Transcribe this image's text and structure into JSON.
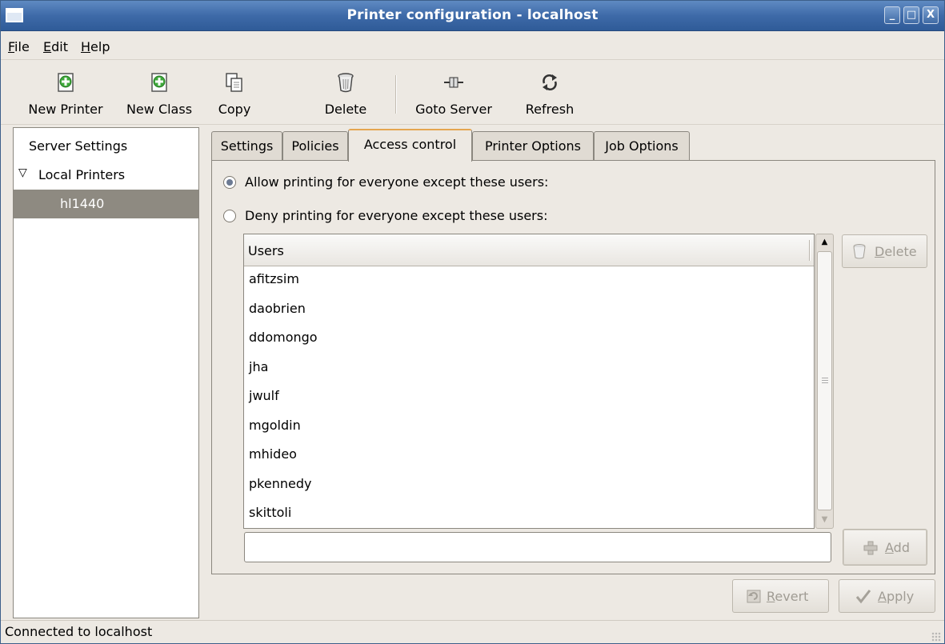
{
  "window": {
    "title": "Printer configuration - localhost",
    "controls": {
      "minimize": "_",
      "maximize": "□",
      "close": "X"
    }
  },
  "menu": [
    {
      "label": "File",
      "mnemonic": "F",
      "rest": "ile"
    },
    {
      "label": "Edit",
      "mnemonic": "E",
      "rest": "dit"
    },
    {
      "label": "Help",
      "mnemonic": "H",
      "rest": "elp"
    }
  ],
  "toolbar": {
    "new_printer": "New Printer",
    "new_class": "New Class",
    "copy": "Copy",
    "delete": "Delete",
    "goto_server": "Goto Server",
    "refresh": "Refresh"
  },
  "sidebar": {
    "server_settings": "Server Settings",
    "local_printers": "Local Printers",
    "printer": "hl1440",
    "selected": "hl1440"
  },
  "tabs": {
    "settings": "Settings",
    "policies": "Policies",
    "access_control": "Access control",
    "printer_options": "Printer Options",
    "job_options": "Job Options",
    "active": "Access control"
  },
  "access": {
    "allow_label": "Allow printing for everyone except these users:",
    "deny_label": "Deny printing for everyone except these users:",
    "selected_mode": "allow",
    "users_header": "Users",
    "users": [
      "afitzsim",
      "daobrien",
      "ddomongo",
      "jha",
      "jwulf",
      "mgoldin",
      "mhideo",
      "pkennedy",
      "skittoli"
    ],
    "entry_value": "",
    "delete_button": {
      "mnemonic": "D",
      "rest": "elete"
    },
    "add_button": {
      "mnemonic": "A",
      "rest": "dd"
    }
  },
  "footer_buttons": {
    "revert": {
      "mnemonic": "R",
      "rest": "evert"
    },
    "apply": {
      "mnemonic": "A",
      "rest": "pply"
    }
  },
  "status": {
    "text": "Connected to localhost"
  },
  "colors": {
    "titlebar": "#3e6aa8",
    "selection": "#8e8a81",
    "window_bg": "#ede9e3",
    "active_tab_accent": "#e5a54f",
    "new_icon_green": "#3ea83a"
  }
}
